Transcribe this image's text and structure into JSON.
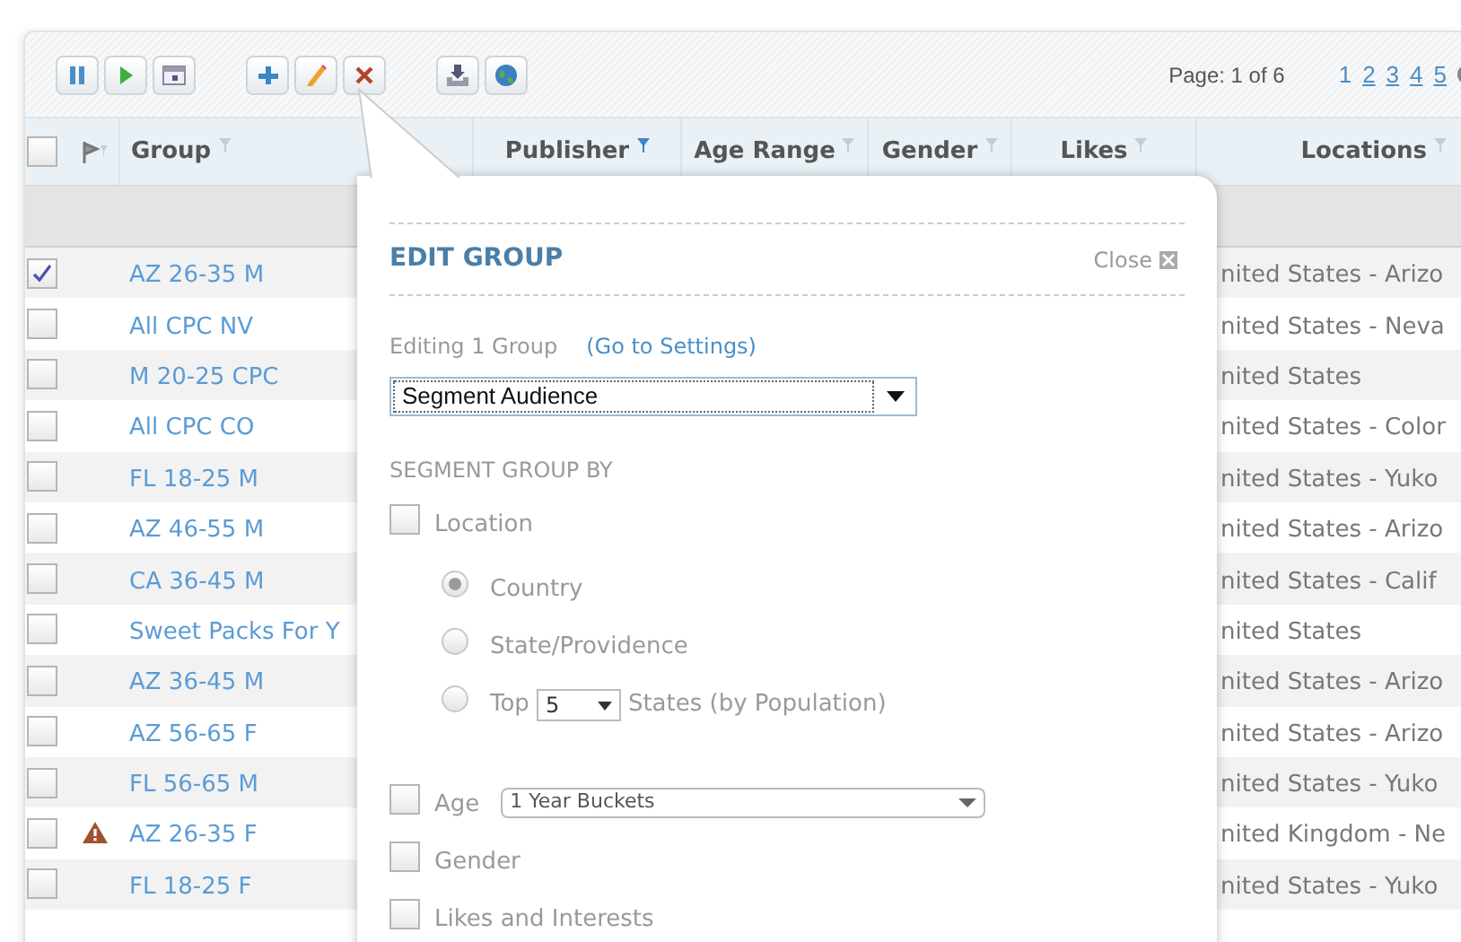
{
  "toolbar": {
    "groups": [
      [
        {
          "kind": "pause"
        },
        {
          "kind": "play"
        },
        {
          "kind": "calendar"
        }
      ],
      [
        {
          "kind": "add"
        },
        {
          "kind": "edit"
        },
        {
          "kind": "delete"
        }
      ],
      [
        {
          "kind": "export"
        },
        {
          "kind": "globe"
        }
      ]
    ]
  },
  "select_all": {
    "checked": false
  },
  "pagination": {
    "label": "Page: 1 of 6",
    "pages": [
      {
        "label": "1",
        "selected": true
      },
      {
        "label": "2",
        "selected": false
      },
      {
        "label": "3",
        "selected": false
      },
      {
        "label": "4",
        "selected": false
      },
      {
        "label": "5",
        "selected": false
      }
    ]
  },
  "columns": [
    {
      "label": "Group",
      "filtered": false
    },
    {
      "label": "Publisher",
      "filtered": true
    },
    {
      "label": "Age Range",
      "filtered": false
    },
    {
      "label": "Gender",
      "filtered": false
    },
    {
      "label": "Likes",
      "filtered": false
    },
    {
      "label": "Locations",
      "filtered": false
    }
  ],
  "rows": [
    {
      "checked": true,
      "warning": false,
      "group": "AZ 26-35 M",
      "location": "nited States - Arizo"
    },
    {
      "checked": false,
      "warning": false,
      "group": "All CPC NV",
      "location": "nited States - Neva"
    },
    {
      "checked": false,
      "warning": false,
      "group": "M 20-25 CPC",
      "location": "nited States"
    },
    {
      "checked": false,
      "warning": false,
      "group": "All CPC CO",
      "location": "nited States - Color"
    },
    {
      "checked": false,
      "warning": false,
      "group": "FL 18-25 M",
      "location": "nited States - Yuko"
    },
    {
      "checked": false,
      "warning": false,
      "group": "AZ 46-55 M",
      "location": "nited States - Arizo"
    },
    {
      "checked": false,
      "warning": false,
      "group": "CA 36-45 M",
      "location": "nited States - Calif"
    },
    {
      "checked": false,
      "warning": false,
      "group": "Sweet Packs For Y",
      "location": "nited States"
    },
    {
      "checked": false,
      "warning": false,
      "group": "AZ 36-45 M",
      "location": "nited States - Arizo"
    },
    {
      "checked": false,
      "warning": false,
      "group": "AZ 56-65 F",
      "location": "nited States - Arizo"
    },
    {
      "checked": false,
      "warning": false,
      "group": "FL 56-65 M",
      "location": "nited States - Yuko"
    },
    {
      "checked": false,
      "warning": true,
      "group": "AZ 26-35 F",
      "location": "nited Kingdom - Ne"
    },
    {
      "checked": false,
      "warning": false,
      "group": "FL 18-25 F",
      "location": "nited States - Yuko"
    }
  ],
  "dialog": {
    "title": "EDIT GROUP",
    "close": "Close",
    "editing": "Editing 1 Group",
    "settings_link": "(Go to Settings)",
    "action": "Segment Audience",
    "section": "SEGMENT GROUP BY",
    "options": [
      {
        "kind": "checkbox",
        "label": "Location",
        "checked": false,
        "children": [
          {
            "kind": "radio",
            "label": "Country",
            "selected": true
          },
          {
            "kind": "radio",
            "label": "State/Providence",
            "selected": false
          },
          {
            "kind": "radio-select",
            "prefix": "Top",
            "value": "5",
            "suffix": "States (by Population)",
            "selected": false
          }
        ]
      },
      {
        "kind": "checkbox-select",
        "label": "Age",
        "checked": false,
        "value": "1 Year Buckets"
      },
      {
        "kind": "checkbox",
        "label": "Gender",
        "checked": false
      },
      {
        "kind": "checkbox",
        "label": "Likes and Interests",
        "checked": false
      }
    ]
  }
}
